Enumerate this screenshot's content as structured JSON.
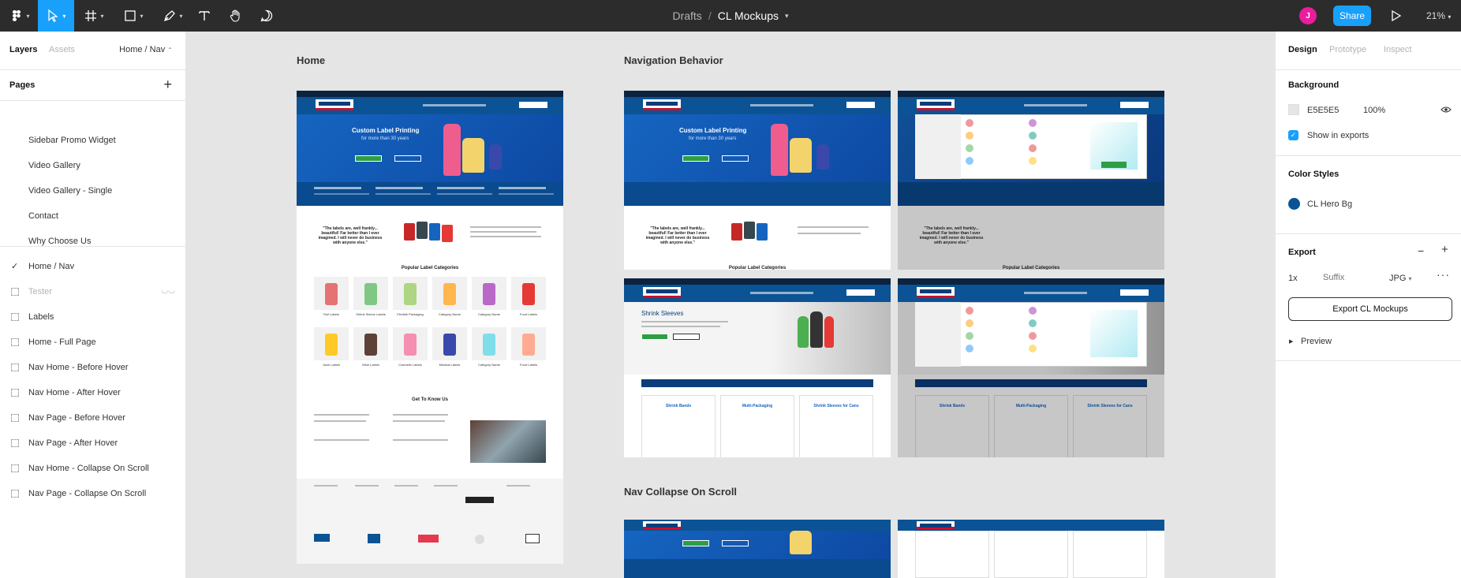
{
  "toolbar": {
    "breadcrumb_folder": "Drafts",
    "breadcrumb_sep": "/",
    "file_name": "CL Mockups",
    "avatar_initial": "J",
    "share_label": "Share",
    "zoom": "21%"
  },
  "left_panel": {
    "tab_layers": "Layers",
    "tab_assets": "Assets",
    "current_page": "Home / Nav",
    "pages_heading": "Pages",
    "add_icon": "+",
    "pages": [
      {
        "label": "Sidebar Promo Widget"
      },
      {
        "label": "Video Gallery"
      },
      {
        "label": "Video Gallery - Single"
      },
      {
        "label": "Contact"
      },
      {
        "label": "Why Choose Us"
      },
      {
        "label": "Home / Nav",
        "selected": true
      },
      {
        "label": "Tester",
        "dim": true
      },
      {
        "label": "Labels"
      },
      {
        "label": "Home - Full Page"
      },
      {
        "label": "Nav Home - Before Hover"
      },
      {
        "label": "Nav Home - After Hover"
      },
      {
        "label": "Nav Page - Before Hover"
      },
      {
        "label": "Nav Page - After Hover"
      },
      {
        "label": "Nav Home - Collapse On Scroll"
      },
      {
        "label": "Nav Page - Collapse On Scroll"
      }
    ]
  },
  "right_panel": {
    "tab_design": "Design",
    "tab_prototype": "Prototype",
    "tab_inspect": "Inspect",
    "background_heading": "Background",
    "background_hex": "E5E5E5",
    "background_opacity": "100%",
    "show_in_exports": "Show in exports",
    "color_styles_heading": "Color Styles",
    "color_style_name": "CL Hero Bg",
    "export_heading": "Export",
    "export_scale": "1x",
    "export_suffix_placeholder": "Suffix",
    "export_format": "JPG",
    "export_button": "Export CL Mockups",
    "preview_label": "Preview"
  },
  "canvas": {
    "frame_home": "Home",
    "frame_nav_behavior": "Navigation Behavior",
    "frame_nav_collapse": "Nav Collapse On Scroll",
    "mock_hero_title": "Custom Label Printing",
    "mock_hero_sub": "for more than 30 years",
    "mock_quote": "\"The labels are, well frankly... beautiful! Far better than I ever imagined. I will never do business with anyone else.\"",
    "mock_popular": "Popular Label Categories",
    "mock_get_to_know": "Get To Know Us",
    "mock_shrink_title": "Shrink Sleeves",
    "mock_card_1": "Shrink Bands",
    "mock_card_2": "Multi-Packaging",
    "mock_card_3": "Shrink Sleeves for Cans",
    "categories_row1": [
      "Roll Labels",
      "Shrink Sleeve Labels",
      "Flexible Packaging",
      "Category Name",
      "Category Name",
      "Food Labels"
    ],
    "categories_row2": [
      "Juice Labels",
      "Wine Labels",
      "Cosmetic Labels",
      "Medical Labels",
      "Category Name",
      "Food Labels"
    ]
  },
  "colors": {
    "accent": "#18a0fb",
    "toolbar_bg": "#2c2c2c",
    "canvas_bg": "#e5e5e5",
    "cl_hero_bg": "#0b5394"
  },
  "icons": [
    "figma-menu-icon",
    "move-tool-icon",
    "frame-tool-icon",
    "shape-tool-icon",
    "pen-tool-icon",
    "text-tool-icon",
    "hand-tool-icon",
    "comment-tool-icon",
    "chevron-down-icon",
    "play-icon",
    "eye-icon",
    "minus-icon",
    "plus-icon",
    "more-icon",
    "caret-right-icon",
    "checkmark-icon"
  ]
}
